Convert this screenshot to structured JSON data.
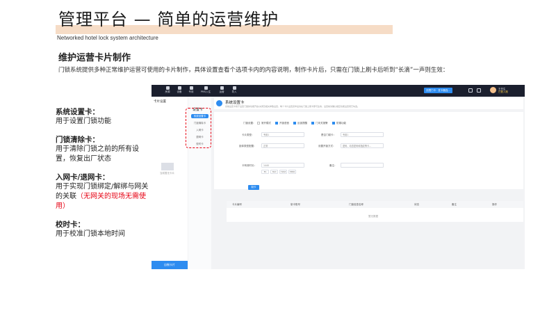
{
  "slide": {
    "title": "管理平台 — 简单的运营维护",
    "subtitle": "Networked hotel lock system architecture",
    "section_heading": "维护运营卡片制作",
    "section_desc": "门锁系统提供多种正常维护运营可使用的卡片制作，具体设置查看个选项卡内的内容说明，制作卡片后，只需在门锁上刷卡后听到“长滴”一声则生效："
  },
  "notes": [
    {
      "title": "系统设置卡：",
      "text": "用于设置门锁功能",
      "red": ""
    },
    {
      "title": "门锁清除卡：",
      "text": "用于清除门锁之前的所有设置，恢复出厂状态",
      "red": ""
    },
    {
      "title": "入网卡/退网卡：",
      "text": "用于实现门锁绑定/解绑与网关的关联",
      "red": "（无网关的现场无需使用）"
    },
    {
      "title": "校时卡：",
      "text": "用于校准门锁本地时间",
      "red": ""
    }
  ],
  "app": {
    "nav": [
      "房源",
      "设备",
      "专用",
      "PMS入住",
      "运营",
      "导入"
    ],
    "top_button": "无限门卡 · 发卡器连...",
    "user_name": "王先生",
    "user_sub": "已登入账",
    "sidebar_title": "卡片设置",
    "sidebar_empty": "当前暂无卡片",
    "sidebar_button": "自制卡片",
    "card_list_title": "设置卡",
    "card_items": [
      "系统设置卡",
      "门锁清除卡",
      "入网卡",
      "退网卡",
      "校时卡"
    ],
    "main_title": "系统设置卡",
    "main_desc": "系统设置卡用于设置门锁的功能开启/关闭及相关参数设置，每个卡片设置完毕后请在门锁上刷卡即可生效，设置前请确认相应功能设置项已勾选。",
    "form": {
      "lock_setting_label": "门锁设置：",
      "checkboxes": [
        {
          "label": "常开模式",
          "on": false
        },
        {
          "label": "开锁语音",
          "on": true
        },
        {
          "label": "反锁提醒",
          "on": true
        },
        {
          "label": "门未关报警",
          "on": true
        },
        {
          "label": "防撬功能",
          "on": true
        }
      ],
      "card_type_label": "卡片类型：",
      "card_type_value": "专用1",
      "special_card_label": "是否门磁卡：",
      "special_card_value": "专用1",
      "lock_mode_label": "锁体类型配置：",
      "lock_mode_value": "正常",
      "unlock_way_label": "设置开锁方式：",
      "unlock_way_value": "密码、动态密码和指纹等卡...",
      "validity_label": "卡有效时长：",
      "validity_placeholder": "1440",
      "validity_chips": [
        "5h",
        "30d",
        "720d",
        "3650"
      ],
      "remark_label": "备注：",
      "make_button": "制卡"
    },
    "table": {
      "headers": [
        "卡片编号",
        "制卡账号",
        "门锁信息名称",
        "状态",
        "备注",
        "操作"
      ],
      "empty": "暂无数据"
    }
  }
}
